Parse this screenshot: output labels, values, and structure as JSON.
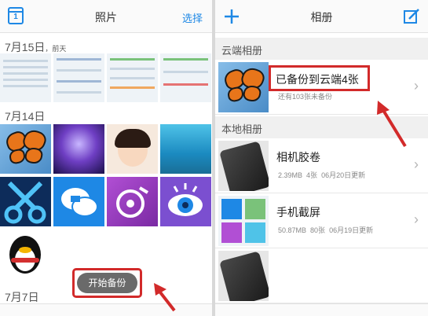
{
  "left_panel": {
    "title": "照片",
    "select_label": "选择",
    "calendar_day": "1",
    "date_groups": [
      {
        "date": "7月15日",
        "suffix": "，前天"
      },
      {
        "date": "7月14日",
        "suffix": ""
      },
      {
        "date": "7月7日",
        "suffix": ""
      }
    ],
    "start_backup_label": "开始备份"
  },
  "right_panel": {
    "title": "相册",
    "cloud_section": "云端相册",
    "cloud_album": {
      "name": "已备份到云端4张",
      "meta": "还有103张未备份"
    },
    "local_section": "本地相册",
    "local_albums": [
      {
        "name": "相机胶卷",
        "size": "2.39MB",
        "count": "4张",
        "updated": "06月20日更新"
      },
      {
        "name": "手机截屏",
        "size": "50.87MB",
        "count": "80张",
        "updated": "06月19日更新"
      }
    ]
  },
  "colors": {
    "accent": "#1e88e5",
    "highlight": "#d22a2a"
  },
  "icons": [
    "calendar-icon",
    "plus-icon",
    "edit-icon",
    "chevron-right-icon",
    "red-arrow-icon"
  ]
}
